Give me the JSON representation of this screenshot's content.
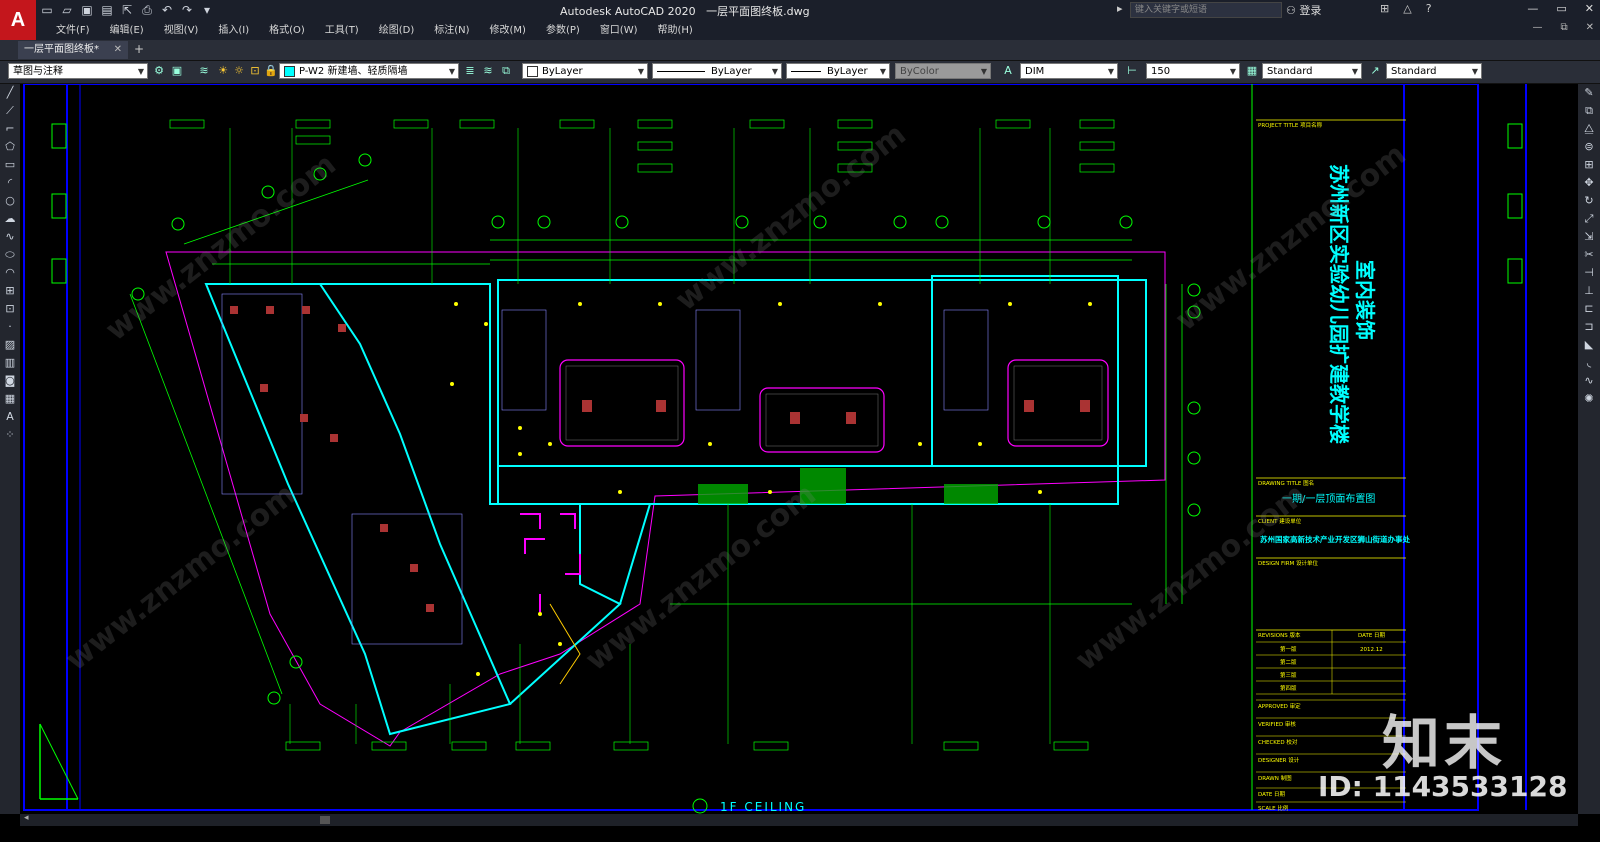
{
  "app": {
    "logo": "A",
    "title": "Autodesk AutoCAD 2020",
    "file": "一层平面图终板.dwg",
    "search_placeholder": "键入关键字或短语",
    "login": "登录"
  },
  "menu": [
    "文件(F)",
    "编辑(E)",
    "视图(V)",
    "插入(I)",
    "格式(O)",
    "工具(T)",
    "绘图(D)",
    "标注(N)",
    "修改(M)",
    "参数(P)",
    "窗口(W)",
    "帮助(H)"
  ],
  "tabs": {
    "active": "一层平面图终板*",
    "add": "+"
  },
  "toolbar": {
    "workspace": "草图与注释",
    "layer": "P-W2 新建墙、轻质隔墙",
    "color": "ByLayer",
    "linetype": "ByLayer",
    "lineweight": "ByLayer",
    "plotstyle": "ByColor",
    "dimstyle": "DIM",
    "scale": "150",
    "textstyle": "Standard",
    "tablestyle": "Standard"
  },
  "drawing": {
    "plan_title": "1F  CEILING",
    "project_title_label": "PROJECT TITLE  项目名称",
    "project_name_line1": "苏州新区实验幼儿园扩建教学楼",
    "project_name_line2": "室内装饰",
    "drawing_title_label": "DRAWING TITLE  图名",
    "drawing_title": "一期/一层顶面布置图",
    "client_label": "CLIENT  建设单位",
    "client": "苏州国家高新技术产业开发区狮山街道办事处",
    "design_firm_label": "DESIGN FIRM  设计单位",
    "revisions_label": "REVISIONS  版本",
    "date_label": "DATE  日期",
    "revisions": [
      "第一版",
      "第二版",
      "第三版",
      "第四版"
    ],
    "rev_date": "2012.12",
    "approved": "APPROVED  审定",
    "verified": "VERIFIED  审核",
    "checked": "CHECKED  校对",
    "designer": "DESIGNER  设计",
    "drawn": "DRAWN  制图",
    "date": "DATE  日期",
    "scale": "SCALE  比例"
  },
  "watermark": {
    "brand": "知末",
    "id": "ID: 1143533128",
    "diag": "www.znzmo.com"
  },
  "colors": {
    "accent": "#c4161c",
    "wall": "#00ffff",
    "dim": "#00ff00",
    "text": "#ffff00",
    "border": "#0000ff",
    "magenta": "#ff00ff"
  }
}
